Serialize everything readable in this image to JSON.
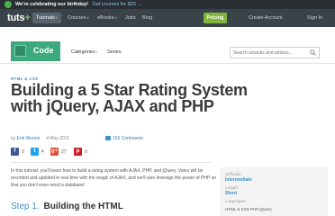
{
  "promo": {
    "bold_text": "We're celebrating our birthday!",
    "link_text": "Get courses for $20 →"
  },
  "nav": {
    "brand": "tuts",
    "brand_plus": "+",
    "items": [
      {
        "label": "Tutorials",
        "caret": "▾"
      },
      {
        "label": "Courses",
        "caret": "▾"
      },
      {
        "label": "eBooks",
        "caret": "▾"
      },
      {
        "label": "Jobs",
        "caret": ""
      },
      {
        "label": "Blog",
        "caret": ""
      }
    ],
    "pricing": "Pricing",
    "create_account": "Create Account",
    "sign_in": "Sign In"
  },
  "subnav": {
    "section": "Code",
    "categories": "Categories",
    "series": "Series",
    "search_placeholder": "Search tutorials and articles..."
  },
  "article": {
    "crumb": "HTML & CSS",
    "title": "Building a 5 Star Rating System with jQuery, AJAX and PHP",
    "by": "by",
    "author": "Erik Wurzer",
    "date": "4 May 2011",
    "comments": "153 Comments",
    "shares": [
      {
        "icon": "facebook-icon",
        "glyph": "f",
        "count": "0"
      },
      {
        "icon": "twitter-icon",
        "glyph": "t",
        "count": "4"
      },
      {
        "icon": "google-plus-icon",
        "glyph": "g+",
        "count": "27"
      },
      {
        "icon": "pinterest-icon",
        "glyph": "p",
        "count": "0"
      }
    ],
    "intro": "In this tutorial, you'll learn how to build a rating system with AJAX, PHP, and jQuery. Votes will be recorded and updated in real-time with the magic of AJAX, and we'll also leverage the power of PHP so that you don't even need a database!",
    "step_label": "Step 1.",
    "step_title": "Building the HTML"
  },
  "sidebar": {
    "difficulty_label": "Difficulty:",
    "difficulty": "Intermediate",
    "length_label": "Length:",
    "length": "Short",
    "languages_label": "Languages:",
    "note": "HTML & CSS  PHP  jQuery"
  },
  "colors": {
    "nav_bg": "#3b434a",
    "accent_green": "#82b540",
    "code_badge": "#3da97e",
    "link_blue": "#3b90c9"
  }
}
